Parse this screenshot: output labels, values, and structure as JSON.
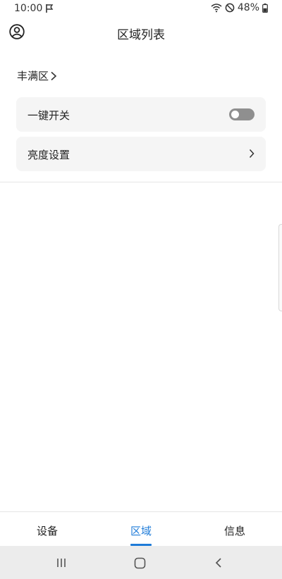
{
  "status_bar": {
    "time": "10:00",
    "battery": "48%",
    "icons": [
      "flag-icon",
      "wifi-icon",
      "do-not-disturb-icon",
      "battery-icon"
    ]
  },
  "header": {
    "title": "区域列表",
    "account_icon": "account-circle-icon"
  },
  "zone_selector": {
    "label": "丰满区"
  },
  "items": [
    {
      "label": "一键开关",
      "control": "toggle",
      "toggle_on": false
    },
    {
      "label": "亮度设置",
      "control": "chevron-right"
    }
  ],
  "tabs": [
    {
      "label": "设备",
      "active": false
    },
    {
      "label": "区域",
      "active": true
    },
    {
      "label": "信息",
      "active": false
    }
  ],
  "colors": {
    "accent": "#1e7bd8",
    "card_background": "#f5f5f5",
    "toggle_off": "#8f8f8f"
  },
  "nav_bar": {
    "icons": [
      "recent-apps-icon",
      "home-icon",
      "back-icon"
    ]
  }
}
